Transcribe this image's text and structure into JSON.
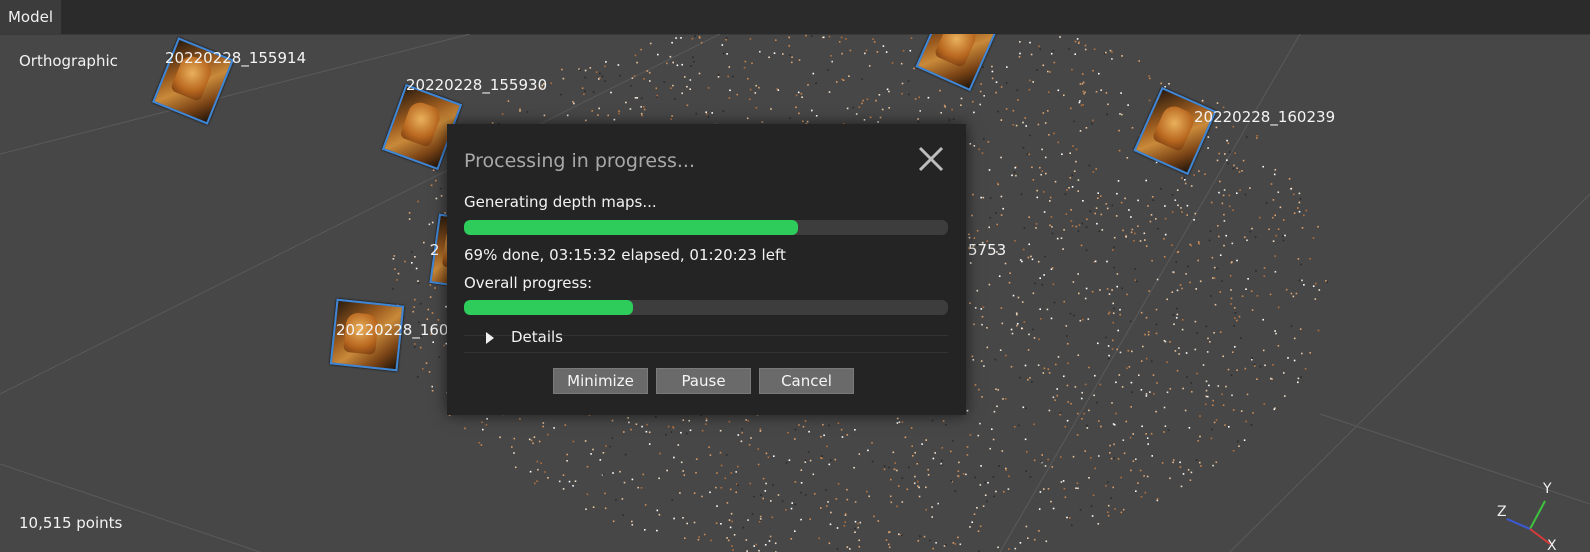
{
  "tabs": [
    {
      "label": "Model"
    }
  ],
  "viewport": {
    "projection_label": "Orthographic",
    "point_count": "10,515 points",
    "cameras": [
      {
        "label": "20220228_155914"
      },
      {
        "label": "20220228_155930"
      },
      {
        "label": "20220228_160239"
      },
      {
        "label": "5753"
      },
      {
        "label": "20220228_160"
      },
      {
        "label": "2"
      }
    ],
    "axes": {
      "x": "X",
      "y": "Y",
      "z": "Z"
    }
  },
  "dialog": {
    "title": "Processing in progress...",
    "task_label": "Generating depth maps...",
    "task_progress": 0.69,
    "status_text": "69% done, 03:15:32 elapsed, 01:20:23 left",
    "overall_label": "Overall progress:",
    "overall_progress": 0.35,
    "details_label": "Details",
    "buttons": {
      "minimize": "Minimize",
      "pause": "Pause",
      "cancel": "Cancel"
    }
  },
  "colors": {
    "progress_fill": "#2ecc5a",
    "camera_frame": "#3f86d6",
    "dialog_bg": "#242424",
    "viewport_bg": "#474747"
  }
}
